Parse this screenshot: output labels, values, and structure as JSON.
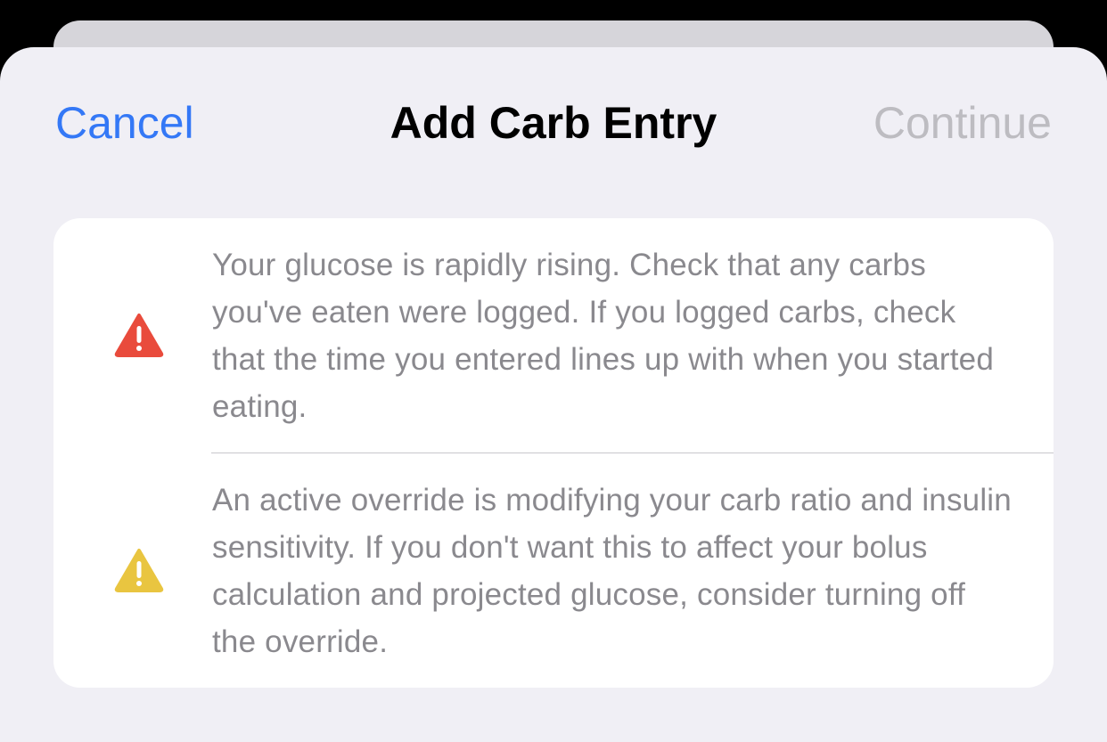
{
  "nav": {
    "cancel_label": "Cancel",
    "title": "Add Carb Entry",
    "continue_label": "Continue"
  },
  "warnings": [
    {
      "icon": "exclamation-triangle-icon",
      "color": "#e94b3c",
      "message": "Your glucose is rapidly rising. Check that any carbs you've eaten were logged. If you logged carbs, check that the time you entered lines up with when you started eating."
    },
    {
      "icon": "exclamation-triangle-icon",
      "color": "#e9c540",
      "message": "An active override is modifying your carb ratio and insulin sensitivity. If you don't want this to affect your bolus calculation and projected glucose, consider turning off the override."
    }
  ],
  "colors": {
    "accent": "#3478f6",
    "disabled": "#bdbcc1",
    "critical": "#e94b3c",
    "warning": "#e9c540"
  }
}
